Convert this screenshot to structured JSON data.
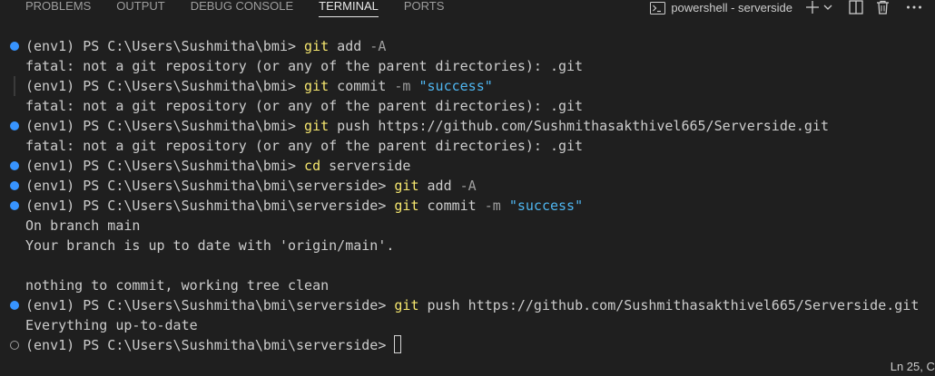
{
  "tabs": [
    {
      "label": "PROBLEMS",
      "active": false
    },
    {
      "label": "OUTPUT",
      "active": false
    },
    {
      "label": "DEBUG CONSOLE",
      "active": false
    },
    {
      "label": "TERMINAL",
      "active": true
    },
    {
      "label": "PORTS",
      "active": false
    }
  ],
  "toolbar": {
    "shell_name": "powershell - serverside",
    "icons": [
      "terminal-icon",
      "plus-icon",
      "chevron-down-icon",
      "split-icon",
      "trash-icon",
      "more-icon"
    ]
  },
  "colors": {
    "background": "#1f1f1f",
    "text": "#cccccc",
    "command": "#f5e66e",
    "string": "#4fb6f0",
    "decoration_blue": "#3794ff"
  },
  "terminal": {
    "lines": [
      {
        "deco": "blue",
        "segments": [
          {
            "t": "(env1) PS C:\\Users\\Sushmitha\\bmi> "
          },
          {
            "t": "git",
            "c": "cmd"
          },
          {
            "t": " add "
          },
          {
            "t": "-A",
            "c": "flag"
          }
        ]
      },
      {
        "deco": "",
        "segments": [
          {
            "t": "fatal: not a git repository (or any of the parent directories): .git"
          }
        ]
      },
      {
        "deco": "bar",
        "segments": [
          {
            "t": "(env1) PS C:\\Users\\Sushmitha\\bmi> "
          },
          {
            "t": "git",
            "c": "cmd"
          },
          {
            "t": " commit "
          },
          {
            "t": "-m",
            "c": "flag"
          },
          {
            "t": " "
          },
          {
            "t": "\"success\"",
            "c": "str"
          }
        ]
      },
      {
        "deco": "",
        "segments": [
          {
            "t": "fatal: not a git repository (or any of the parent directories): .git"
          }
        ]
      },
      {
        "deco": "blue",
        "segments": [
          {
            "t": "(env1) PS C:\\Users\\Sushmitha\\bmi> "
          },
          {
            "t": "git",
            "c": "cmd"
          },
          {
            "t": " push https://github.com/Sushmithasakthivel665/Serverside.git"
          }
        ]
      },
      {
        "deco": "",
        "segments": [
          {
            "t": "fatal: not a git repository (or any of the parent directories): .git"
          }
        ]
      },
      {
        "deco": "blue",
        "segments": [
          {
            "t": "(env1) PS C:\\Users\\Sushmitha\\bmi> "
          },
          {
            "t": "cd",
            "c": "cmd"
          },
          {
            "t": " serverside"
          }
        ]
      },
      {
        "deco": "blue",
        "segments": [
          {
            "t": "(env1) PS C:\\Users\\Sushmitha\\bmi\\serverside> "
          },
          {
            "t": "git",
            "c": "cmd"
          },
          {
            "t": " add "
          },
          {
            "t": "-A",
            "c": "flag"
          }
        ]
      },
      {
        "deco": "blue",
        "segments": [
          {
            "t": "(env1) PS C:\\Users\\Sushmitha\\bmi\\serverside> "
          },
          {
            "t": "git",
            "c": "cmd"
          },
          {
            "t": " commit "
          },
          {
            "t": "-m",
            "c": "flag"
          },
          {
            "t": " "
          },
          {
            "t": "\"success\"",
            "c": "str"
          }
        ]
      },
      {
        "deco": "",
        "segments": [
          {
            "t": "On branch main"
          }
        ]
      },
      {
        "deco": "",
        "segments": [
          {
            "t": "Your branch is up to date with 'origin/main'."
          }
        ]
      },
      {
        "deco": "",
        "segments": []
      },
      {
        "deco": "",
        "segments": [
          {
            "t": "nothing to commit, working tree clean"
          }
        ]
      },
      {
        "deco": "blue",
        "segments": [
          {
            "t": "(env1) PS C:\\Users\\Sushmitha\\bmi\\serverside> "
          },
          {
            "t": "git",
            "c": "cmd"
          },
          {
            "t": " push https://github.com/Sushmithasakthivel665/Serverside.git"
          }
        ]
      },
      {
        "deco": "",
        "segments": [
          {
            "t": "Everything up-to-date"
          }
        ]
      },
      {
        "deco": "hollow",
        "segments": [
          {
            "t": "(env1) PS C:\\Users\\Sushmitha\\bmi\\serverside> "
          }
        ],
        "cursor": true
      }
    ]
  },
  "status": {
    "position": "Ln 25, Col 1 (2"
  }
}
